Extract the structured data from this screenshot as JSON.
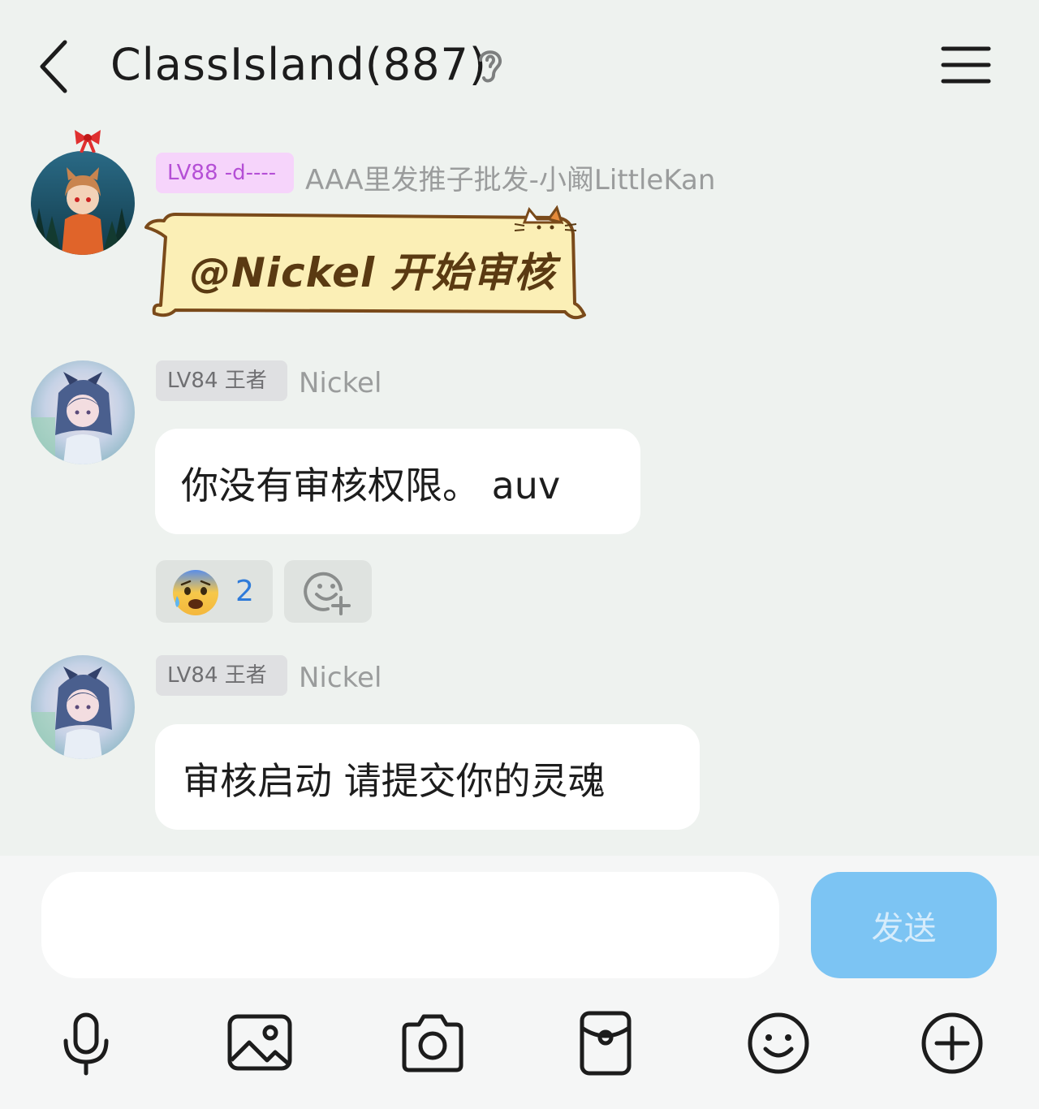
{
  "header": {
    "title": "ClassIsland(887)",
    "back_icon": "chevron-left-icon",
    "ear_icon": "ear-icon",
    "menu_icon": "hamburger-menu-icon"
  },
  "messages": [
    {
      "level_badge": "LV88 -d----",
      "sender": "AAA里发推子批发-小阚LittleKan",
      "sticker_text": "@Nickel 开始审核"
    },
    {
      "level_badge": "LV84 王者",
      "sender": "Nickel",
      "text": "你没有审核权限。 auv",
      "reaction": {
        "emoji": "😰",
        "count": "2"
      }
    },
    {
      "level_badge": "LV84 王者",
      "sender": "Nickel",
      "text": "审核启动 请提交你的灵魂"
    }
  ],
  "composer": {
    "input_value": "",
    "send_label": "发送"
  },
  "colors": {
    "background": "#eef2ef",
    "send_button": "#7cc4f3",
    "lv88_badge": "#f6d4fb",
    "reaction_count": "#2f7bd9"
  },
  "toolbar": [
    "microphone-icon",
    "image-icon",
    "camera-icon",
    "red-packet-icon",
    "emoji-icon",
    "plus-icon"
  ]
}
